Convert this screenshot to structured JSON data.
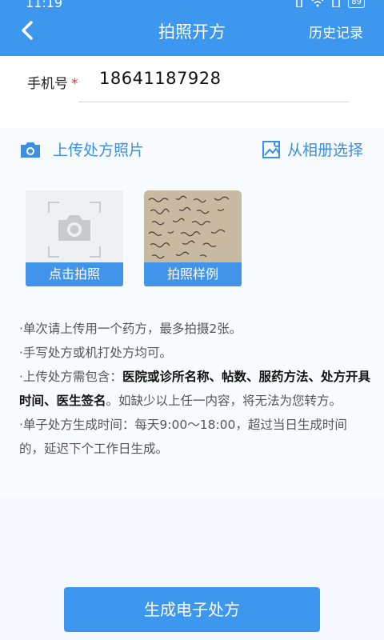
{
  "status_bar": {
    "time": "11:19",
    "battery": "89"
  },
  "header": {
    "title": "拍照开方",
    "history": "历史记录"
  },
  "phone": {
    "label": "手机号",
    "required_mark": "*",
    "value": "18641187928"
  },
  "upload": {
    "title": "上传处方照片",
    "album": "从相册选择",
    "take_photo": "点击拍照",
    "sample": "拍照样例"
  },
  "notes": {
    "line1": "·单次请上传用一个药方，最多拍摄2张。",
    "line2": "·手写处方或机打处方均可。",
    "line3_prefix": "·上传处方需包含：",
    "line3_bold": "医院或诊所名称、帖数、服药方法、处方开具时间、医生签名",
    "line3_suffix": "。如缺少以上任一内容，将无法为您转方。",
    "line4": "·单子处方生成时间：每天9:00～18:00，超过当日生成时间的，延迟下个工作日生成。"
  },
  "button": {
    "generate": "生成电子处方"
  },
  "colors": {
    "primary": "#3d97ef",
    "accent": "#3d8fe0",
    "required": "#e33333"
  }
}
